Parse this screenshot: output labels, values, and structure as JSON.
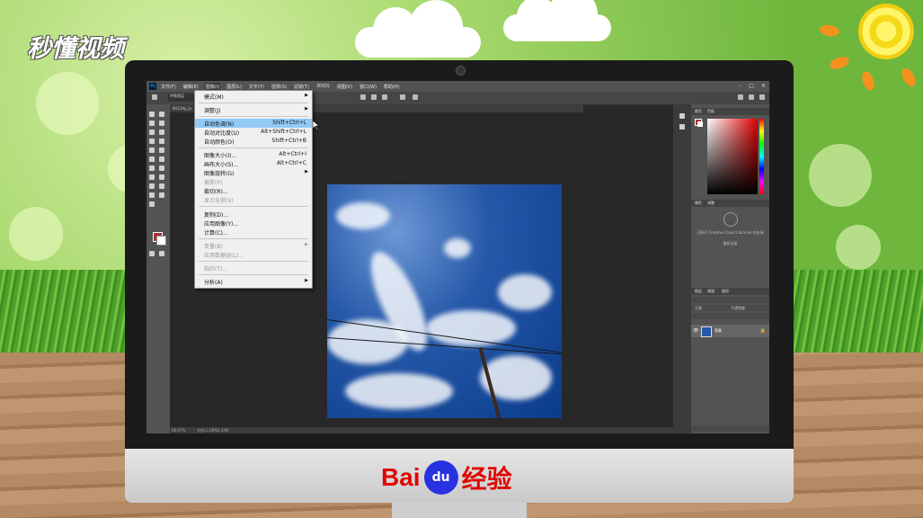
{
  "branding": {
    "watermark_top_left": "秒懂视频",
    "baidu_text": "Bai",
    "baidu_paw": "du",
    "baidu_suffix": "经验"
  },
  "menubar": {
    "items": [
      "文件(F)",
      "编辑(E)",
      "图像(I)",
      "图层(L)",
      "文字(Y)",
      "选择(S)",
      "滤镜(T)",
      "3D(D)",
      "视图(V)",
      "窗口(W)",
      "帮助(H)"
    ],
    "active_index": 2
  },
  "document": {
    "tab_label": "8U12Ay_Jo",
    "zoom": "66.67%",
    "doc_size": "文档:2.34M/2.34M"
  },
  "options_bar": {
    "select_label": "特殊图层"
  },
  "image_menu": {
    "mode": "模式(M)",
    "adjustments": "调整(J)",
    "auto_tone": "自动色调(N)",
    "auto_tone_shortcut": "Shift+Ctrl+L",
    "auto_contrast": "自动对比度(U)",
    "auto_contrast_shortcut": "Alt+Shift+Ctrl+L",
    "auto_color": "自动颜色(O)",
    "auto_color_shortcut": "Shift+Ctrl+B",
    "image_size": "图像大小(I)...",
    "image_size_shortcut": "Alt+Ctrl+I",
    "canvas_size": "画布大小(S)...",
    "canvas_size_shortcut": "Alt+Ctrl+C",
    "image_rotation": "图像旋转(G)",
    "crop": "裁剪(P)",
    "trim": "裁切(R)...",
    "reveal_all": "显示全部(V)",
    "duplicate": "复制(D)...",
    "apply_image": "应用图像(Y)...",
    "calculations": "计算(C)...",
    "variables": "变量(B)",
    "apply_data_set": "应用数据组(L)...",
    "trap": "陷印(T)...",
    "analysis": "分析(A)"
  },
  "panels": {
    "color_tab": "颜色",
    "swatches_tab": "色板",
    "properties_tab": "属性",
    "adjust_tab": "调整",
    "cc_text": "已断开 Creative Cloud Libraries 的连接",
    "cc_link": "重新连接",
    "layers_tab": "图层",
    "channels_tab": "通道",
    "paths_tab": "路径",
    "layer_name": "背景",
    "blend_mode": "正常",
    "opacity": "不透明度:"
  },
  "colors": {
    "foreground": "#a53434",
    "menu_highlight": "#91c9f7",
    "photoshop_ui": "#535353"
  }
}
